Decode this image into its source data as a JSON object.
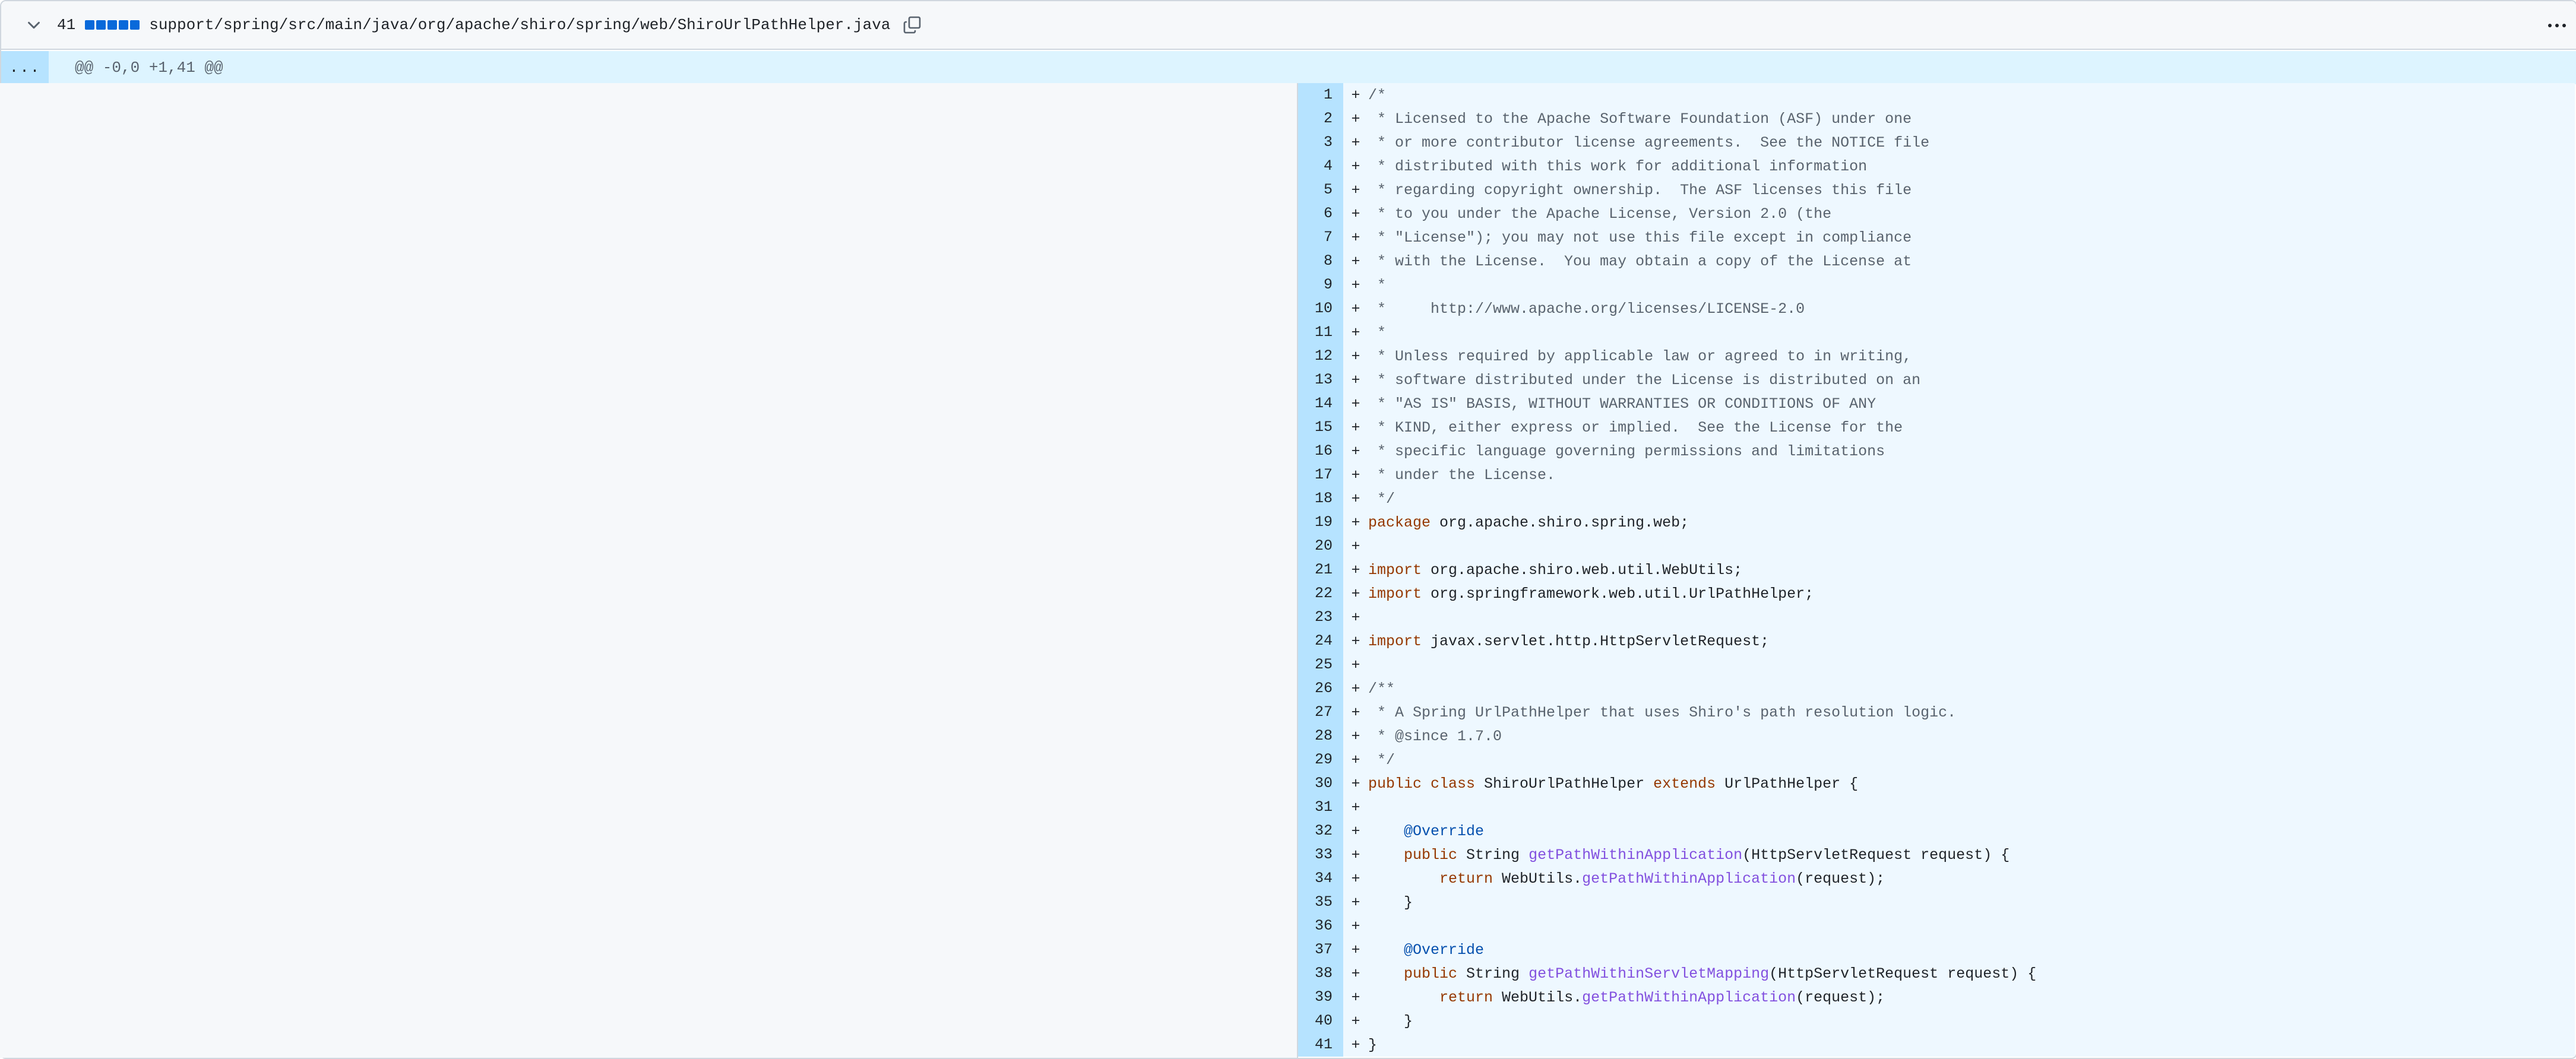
{
  "file_header": {
    "changes_count": "41",
    "diffstat_squares": 5,
    "file_path": "support/spring/src/main/java/org/apache/shiro/spring/web/ShiroUrlPathHelper.java",
    "accent_color": "#0969da"
  },
  "hunk": {
    "expand_label": "...",
    "header": "@@ -0,0 +1,41 @@"
  },
  "lines": [
    {
      "n": "1",
      "m": "+",
      "t": [
        [
          "c",
          "/*"
        ]
      ]
    },
    {
      "n": "2",
      "m": "+",
      "t": [
        [
          "c",
          " * Licensed to the Apache Software Foundation (ASF) under one"
        ]
      ]
    },
    {
      "n": "3",
      "m": "+",
      "t": [
        [
          "c",
          " * or more contributor license agreements.  See the NOTICE file"
        ]
      ]
    },
    {
      "n": "4",
      "m": "+",
      "t": [
        [
          "c",
          " * distributed with this work for additional information"
        ]
      ]
    },
    {
      "n": "5",
      "m": "+",
      "t": [
        [
          "c",
          " * regarding copyright ownership.  The ASF licenses this file"
        ]
      ]
    },
    {
      "n": "6",
      "m": "+",
      "t": [
        [
          "c",
          " * to you under the Apache License, Version 2.0 (the"
        ]
      ]
    },
    {
      "n": "7",
      "m": "+",
      "t": [
        [
          "c",
          " * \"License\"); you may not use this file except in compliance"
        ]
      ]
    },
    {
      "n": "8",
      "m": "+",
      "t": [
        [
          "c",
          " * with the License.  You may obtain a copy of the License at"
        ]
      ]
    },
    {
      "n": "9",
      "m": "+",
      "t": [
        [
          "c",
          " *"
        ]
      ]
    },
    {
      "n": "10",
      "m": "+",
      "t": [
        [
          "c",
          " *     http://www.apache.org/licenses/LICENSE-2.0"
        ]
      ]
    },
    {
      "n": "11",
      "m": "+",
      "t": [
        [
          "c",
          " *"
        ]
      ]
    },
    {
      "n": "12",
      "m": "+",
      "t": [
        [
          "c",
          " * Unless required by applicable law or agreed to in writing,"
        ]
      ]
    },
    {
      "n": "13",
      "m": "+",
      "t": [
        [
          "c",
          " * software distributed under the License is distributed on an"
        ]
      ]
    },
    {
      "n": "14",
      "m": "+",
      "t": [
        [
          "c",
          " * \"AS IS\" BASIS, WITHOUT WARRANTIES OR CONDITIONS OF ANY"
        ]
      ]
    },
    {
      "n": "15",
      "m": "+",
      "t": [
        [
          "c",
          " * KIND, either express or implied.  See the License for the"
        ]
      ]
    },
    {
      "n": "16",
      "m": "+",
      "t": [
        [
          "c",
          " * specific language governing permissions and limitations"
        ]
      ]
    },
    {
      "n": "17",
      "m": "+",
      "t": [
        [
          "c",
          " * under the License."
        ]
      ]
    },
    {
      "n": "18",
      "m": "+",
      "t": [
        [
          "c",
          " */"
        ]
      ]
    },
    {
      "n": "19",
      "m": "+",
      "t": [
        [
          "k",
          "package"
        ],
        [
          "p",
          " org.apache.shiro.spring.web;"
        ]
      ]
    },
    {
      "n": "20",
      "m": "+",
      "t": []
    },
    {
      "n": "21",
      "m": "+",
      "t": [
        [
          "k",
          "import"
        ],
        [
          "p",
          " org.apache.shiro.web.util.WebUtils;"
        ]
      ]
    },
    {
      "n": "22",
      "m": "+",
      "t": [
        [
          "k",
          "import"
        ],
        [
          "p",
          " org.springframework.web.util.UrlPathHelper;"
        ]
      ]
    },
    {
      "n": "23",
      "m": "+",
      "t": []
    },
    {
      "n": "24",
      "m": "+",
      "t": [
        [
          "k",
          "import"
        ],
        [
          "p",
          " javax.servlet.http.HttpServletRequest;"
        ]
      ]
    },
    {
      "n": "25",
      "m": "+",
      "t": []
    },
    {
      "n": "26",
      "m": "+",
      "t": [
        [
          "c",
          "/**"
        ]
      ]
    },
    {
      "n": "27",
      "m": "+",
      "t": [
        [
          "c",
          " * A Spring UrlPathHelper that uses Shiro's path resolution logic."
        ]
      ]
    },
    {
      "n": "28",
      "m": "+",
      "t": [
        [
          "c",
          " * @since 1.7.0"
        ]
      ]
    },
    {
      "n": "29",
      "m": "+",
      "t": [
        [
          "c",
          " */"
        ]
      ]
    },
    {
      "n": "30",
      "m": "+",
      "t": [
        [
          "k",
          "public"
        ],
        [
          "p",
          " "
        ],
        [
          "k",
          "class"
        ],
        [
          "p",
          " ShiroUrlPathHelper "
        ],
        [
          "k",
          "extends"
        ],
        [
          "p",
          " UrlPathHelper {"
        ]
      ]
    },
    {
      "n": "31",
      "m": "+",
      "t": []
    },
    {
      "n": "32",
      "m": "+",
      "t": [
        [
          "p",
          "    "
        ],
        [
          "a",
          "@Override"
        ]
      ]
    },
    {
      "n": "33",
      "m": "+",
      "t": [
        [
          "p",
          "    "
        ],
        [
          "k",
          "public"
        ],
        [
          "p",
          " String "
        ],
        [
          "f",
          "getPathWithinApplication"
        ],
        [
          "p",
          "(HttpServletRequest request) {"
        ]
      ]
    },
    {
      "n": "34",
      "m": "+",
      "t": [
        [
          "p",
          "        "
        ],
        [
          "k",
          "return"
        ],
        [
          "p",
          " WebUtils."
        ],
        [
          "f",
          "getPathWithinApplication"
        ],
        [
          "p",
          "(request);"
        ]
      ]
    },
    {
      "n": "35",
      "m": "+",
      "t": [
        [
          "p",
          "    }"
        ]
      ]
    },
    {
      "n": "36",
      "m": "+",
      "t": []
    },
    {
      "n": "37",
      "m": "+",
      "t": [
        [
          "p",
          "    "
        ],
        [
          "a",
          "@Override"
        ]
      ]
    },
    {
      "n": "38",
      "m": "+",
      "t": [
        [
          "p",
          "    "
        ],
        [
          "k",
          "public"
        ],
        [
          "p",
          " String "
        ],
        [
          "f",
          "getPathWithinServletMapping"
        ],
        [
          "p",
          "(HttpServletRequest request) {"
        ]
      ]
    },
    {
      "n": "39",
      "m": "+",
      "t": [
        [
          "p",
          "        "
        ],
        [
          "k",
          "return"
        ],
        [
          "p",
          " WebUtils."
        ],
        [
          "f",
          "getPathWithinApplication"
        ],
        [
          "p",
          "(request);"
        ]
      ]
    },
    {
      "n": "40",
      "m": "+",
      "t": [
        [
          "p",
          "    }"
        ]
      ]
    },
    {
      "n": "41",
      "m": "+",
      "t": [
        [
          "p",
          "}"
        ]
      ]
    }
  ]
}
